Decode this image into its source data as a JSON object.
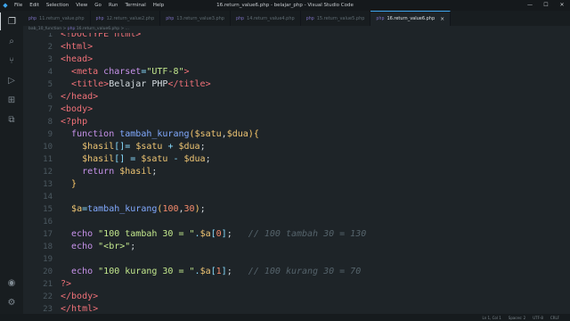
{
  "window": {
    "title": "16.return_value6.php - belajar_php - Visual Studio Code",
    "menu": [
      "File",
      "Edit",
      "Selection",
      "View",
      "Go",
      "Run",
      "Terminal",
      "Help"
    ],
    "controls": [
      "—",
      "☐",
      "✕"
    ]
  },
  "activity_bar": [
    {
      "name": "explorer-icon",
      "glyph": "❐"
    },
    {
      "name": "search-icon",
      "glyph": "⌕"
    },
    {
      "name": "source-control-icon",
      "glyph": "⑂"
    },
    {
      "name": "run-debug-icon",
      "glyph": "▷"
    },
    {
      "name": "extensions-icon",
      "glyph": "⊞"
    },
    {
      "name": "remote-icon",
      "glyph": "⧉"
    },
    {
      "name": "accounts-icon",
      "glyph": "◉"
    },
    {
      "name": "settings-icon",
      "glyph": "⚙"
    }
  ],
  "tabs": [
    {
      "label": "11.return_value.php",
      "active": false
    },
    {
      "label": "12.return_value2.php",
      "active": false
    },
    {
      "label": "13.return_value3.php",
      "active": false
    },
    {
      "label": "14.return_value4.php",
      "active": false
    },
    {
      "label": "15.return_value5.php",
      "active": false
    },
    {
      "label": "16.return_value6.php",
      "active": true,
      "close": "×"
    }
  ],
  "file_icon": "php",
  "breadcrumb": {
    "folder": "bab_10_function",
    "separator": ">",
    "file": "16.return_value6.php",
    "tail": "> ..."
  },
  "editor": {
    "lines": [
      {
        "n": "1",
        "tokens": [
          [
            "tk-tag",
            "<!DOCTYPE html>"
          ]
        ]
      },
      {
        "n": "2",
        "tokens": [
          [
            "tk-tag",
            "<html>"
          ]
        ]
      },
      {
        "n": "3",
        "tokens": [
          [
            "tk-tag",
            "<head>"
          ]
        ]
      },
      {
        "n": "4",
        "tokens": [
          [
            "tk-plain",
            "  "
          ],
          [
            "tk-tag",
            "<meta "
          ],
          [
            "tk-attr",
            "charset"
          ],
          [
            "tk-op",
            "="
          ],
          [
            "tk-str",
            "\"UTF-8\""
          ],
          [
            "tk-tag",
            ">"
          ]
        ]
      },
      {
        "n": "5",
        "tokens": [
          [
            "tk-plain",
            "  "
          ],
          [
            "tk-tag",
            "<title>"
          ],
          [
            "tk-text",
            "Belajar PHP"
          ],
          [
            "tk-tag",
            "</title>"
          ]
        ]
      },
      {
        "n": "6",
        "tokens": [
          [
            "tk-tag",
            "</head>"
          ]
        ]
      },
      {
        "n": "7",
        "tokens": [
          [
            "tk-tag",
            "<body>"
          ]
        ]
      },
      {
        "n": "8",
        "tokens": [
          [
            "tk-php",
            "<?php"
          ]
        ]
      },
      {
        "n": "9",
        "tokens": [
          [
            "tk-plain",
            "  "
          ],
          [
            "tk-kw",
            "function "
          ],
          [
            "tk-fn",
            "tambah_kurang"
          ],
          [
            "tk-br",
            "("
          ],
          [
            "tk-var",
            "$satu"
          ],
          [
            "tk-plain",
            ","
          ],
          [
            "tk-var",
            "$dua"
          ],
          [
            "tk-br",
            ")"
          ],
          [
            "tk-br",
            "{"
          ]
        ]
      },
      {
        "n": "10",
        "tokens": [
          [
            "tk-plain",
            "    "
          ],
          [
            "tk-var",
            "$hasil"
          ],
          [
            "tk-op",
            "[]"
          ],
          [
            "tk-op",
            "= "
          ],
          [
            "tk-var",
            "$satu"
          ],
          [
            "tk-op",
            " + "
          ],
          [
            "tk-var",
            "$dua"
          ],
          [
            "tk-plain",
            ";"
          ]
        ]
      },
      {
        "n": "11",
        "tokens": [
          [
            "tk-plain",
            "    "
          ],
          [
            "tk-var",
            "$hasil"
          ],
          [
            "tk-op",
            "[] = "
          ],
          [
            "tk-var",
            "$satu"
          ],
          [
            "tk-op",
            " - "
          ],
          [
            "tk-var",
            "$dua"
          ],
          [
            "tk-plain",
            ";"
          ]
        ]
      },
      {
        "n": "12",
        "tokens": [
          [
            "tk-plain",
            "    "
          ],
          [
            "tk-kw",
            "return "
          ],
          [
            "tk-var",
            "$hasil"
          ],
          [
            "tk-plain",
            ";"
          ]
        ]
      },
      {
        "n": "13",
        "tokens": [
          [
            "tk-plain",
            "  "
          ],
          [
            "tk-br",
            "}"
          ]
        ]
      },
      {
        "n": "14",
        "tokens": []
      },
      {
        "n": "15",
        "tokens": [
          [
            "tk-plain",
            "  "
          ],
          [
            "tk-var",
            "$a"
          ],
          [
            "tk-op",
            "="
          ],
          [
            "tk-fn",
            "tambah_kurang"
          ],
          [
            "tk-br",
            "("
          ],
          [
            "tk-num",
            "100"
          ],
          [
            "tk-plain",
            ","
          ],
          [
            "tk-num",
            "30"
          ],
          [
            "tk-br",
            ")"
          ],
          [
            "tk-plain",
            ";"
          ]
        ]
      },
      {
        "n": "16",
        "tokens": []
      },
      {
        "n": "17",
        "tokens": [
          [
            "tk-plain",
            "  "
          ],
          [
            "tk-kw",
            "echo "
          ],
          [
            "tk-str",
            "\"100 tambah 30 = \""
          ],
          [
            "tk-op",
            "."
          ],
          [
            "tk-var",
            "$a"
          ],
          [
            "tk-op",
            "["
          ],
          [
            "tk-num",
            "0"
          ],
          [
            "tk-op",
            "]"
          ],
          [
            "tk-plain",
            ";   "
          ],
          [
            "tk-cm",
            "// 100 tambah 30 = 130"
          ]
        ]
      },
      {
        "n": "18",
        "tokens": [
          [
            "tk-plain",
            "  "
          ],
          [
            "tk-kw",
            "echo "
          ],
          [
            "tk-str",
            "\"<br>\""
          ],
          [
            "tk-plain",
            ";"
          ]
        ]
      },
      {
        "n": "19",
        "tokens": []
      },
      {
        "n": "20",
        "tokens": [
          [
            "tk-plain",
            "  "
          ],
          [
            "tk-kw",
            "echo "
          ],
          [
            "tk-str",
            "\"100 kurang 30 = \""
          ],
          [
            "tk-op",
            "."
          ],
          [
            "tk-var",
            "$a"
          ],
          [
            "tk-op",
            "["
          ],
          [
            "tk-num",
            "1"
          ],
          [
            "tk-op",
            "]"
          ],
          [
            "tk-plain",
            ";   "
          ],
          [
            "tk-cm",
            "// 100 kurang 30 = 70"
          ]
        ]
      },
      {
        "n": "21",
        "tokens": [
          [
            "tk-php",
            "?>"
          ]
        ]
      },
      {
        "n": "22",
        "tokens": [
          [
            "tk-tag",
            "</body>"
          ]
        ]
      },
      {
        "n": "23",
        "tokens": [
          [
            "tk-tag",
            "</html>"
          ]
        ]
      }
    ]
  },
  "status_bar": {
    "position": "Ln 1, Col 1",
    "spaces": "Spaces: 2",
    "encoding": "UTF-8",
    "eol": "CRLF"
  }
}
